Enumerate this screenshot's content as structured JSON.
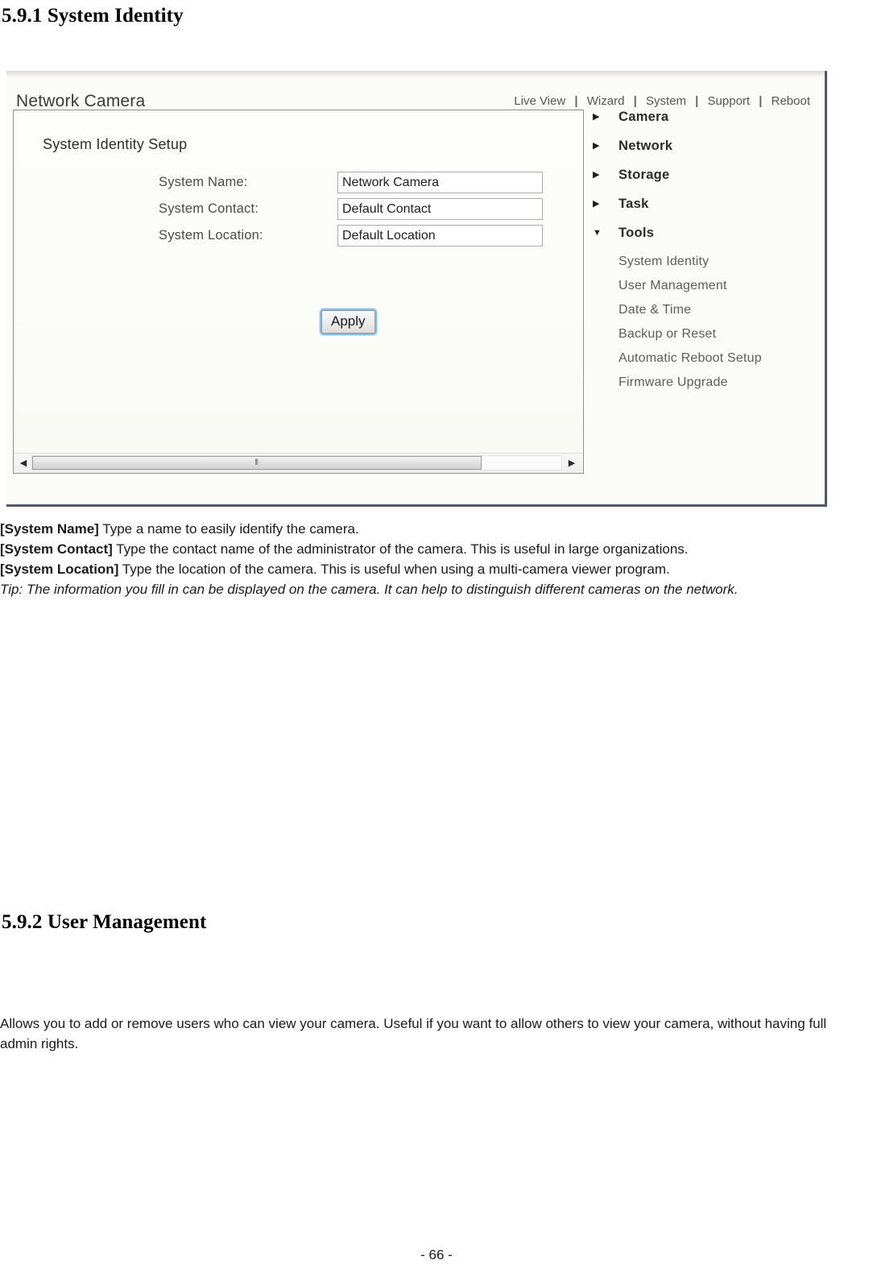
{
  "document": {
    "heading_591": "5.9.1 System Identity",
    "heading_592": "5.9.2 User Management",
    "footer": "- 66 -",
    "descriptions": {
      "system_name_term": "[System Name]",
      "system_name_text": " Type a name to easily identify the camera.",
      "system_contact_term": "[System Contact]",
      "system_contact_text": " Type the contact name of the administrator of the camera. This is useful in large organizations.",
      "system_location_term": "[System Location]",
      "system_location_text": " Type the location of the camera. This is useful when using a multi-camera viewer program.",
      "tip": "Tip: The information you fill in can be displayed on the camera. It can help to distinguish different cameras on the network."
    },
    "user_management_intro": "Allows you to add or remove users who can view your camera. Useful if you want to allow others to view your camera, without having full admin rights."
  },
  "screenshot": {
    "brand": "Network Camera",
    "nav": [
      {
        "label": "Live View"
      },
      {
        "label": "Wizard"
      },
      {
        "label": "System"
      },
      {
        "label": "Support"
      },
      {
        "label": "Reboot"
      }
    ],
    "nav_separator": "|",
    "panel": {
      "title": "System Identity Setup",
      "fields": [
        {
          "label": "System Name:",
          "value": "Network Camera"
        },
        {
          "label": "System Contact:",
          "value": "Default Contact"
        },
        {
          "label": "System Location:",
          "value": "Default Location"
        }
      ],
      "apply_label": "Apply"
    },
    "scrollbar": {
      "left_arrow": "◀",
      "right_arrow": "▶",
      "grip": "⦀"
    },
    "sidebar": {
      "collapsed_arrow": "▶",
      "expanded_arrow": "▼",
      "groups": [
        {
          "label": "Camera",
          "expanded": false
        },
        {
          "label": "Network",
          "expanded": false
        },
        {
          "label": "Storage",
          "expanded": false
        },
        {
          "label": "Task",
          "expanded": false
        },
        {
          "label": "Tools",
          "expanded": true
        }
      ],
      "tools_children": [
        {
          "label": "System Identity"
        },
        {
          "label": "User Management"
        },
        {
          "label": "Date & Time"
        },
        {
          "label": "Backup or Reset"
        },
        {
          "label": "Automatic Reboot Setup"
        },
        {
          "label": "Firmware Upgrade"
        }
      ]
    }
  }
}
